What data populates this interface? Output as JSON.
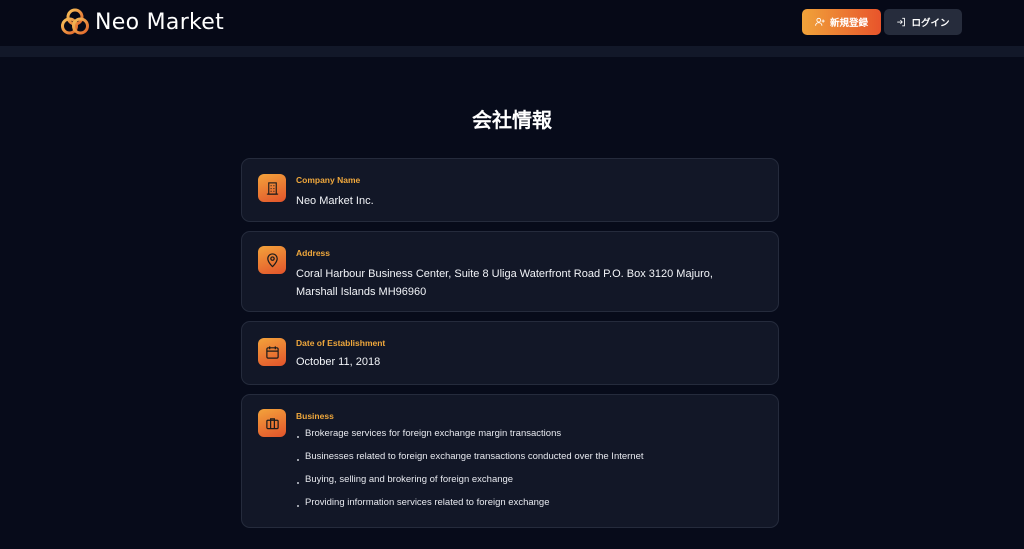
{
  "header": {
    "brand": "Neo Market",
    "register_label": "新規登録",
    "login_label": "ログイン"
  },
  "page": {
    "title": "会社情報"
  },
  "company": {
    "name_label": "Company Name",
    "name_value": "Neo Market Inc.",
    "address_label": "Address",
    "address_value": "Coral Harbour Business Center, Suite 8 Uliga Waterfront Road P.O. Box 3120 Majuro, Marshall Islands MH96960",
    "date_label": "Date of Establishment",
    "date_value": "October 11, 2018",
    "business_label": "Business",
    "business_items": [
      "Brokerage services for foreign exchange margin transactions",
      "Businesses related to foreign exchange transactions conducted over the Internet",
      "Buying, selling and brokering of foreign exchange",
      "Providing information services related to foreign exchange"
    ]
  },
  "colors": {
    "background": "#070b1a",
    "card": "#121727",
    "accent_orange": "#f0a83c",
    "accent_red": "#e2532b"
  },
  "icons": {
    "logo": "trinity-knot-logo",
    "register": "user-plus-icon",
    "login": "login-arrow-icon",
    "company": "building-icon",
    "address": "map-pin-icon",
    "date": "calendar-icon",
    "business": "briefcase-icon"
  }
}
